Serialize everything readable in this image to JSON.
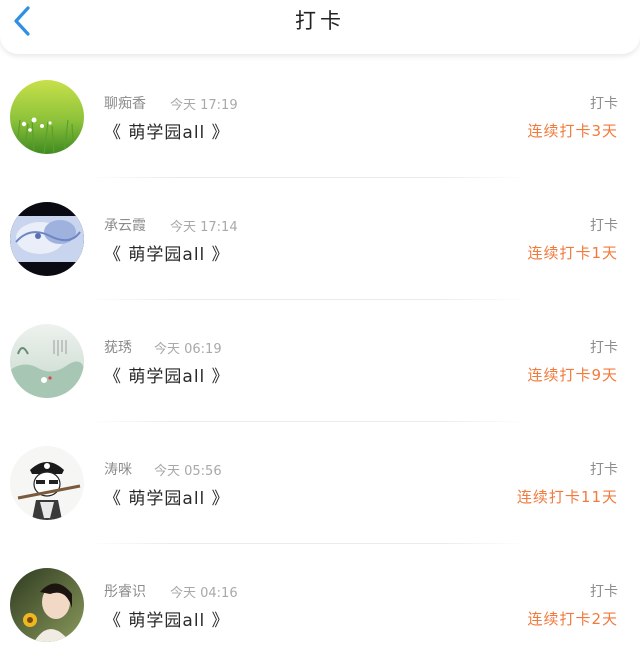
{
  "header": {
    "back_icon": "chevron-left-icon",
    "title": "打卡",
    "accent_color": "#2f8fe4"
  },
  "checkins": [
    {
      "name": "聊痴香",
      "time": "今天 17:19",
      "book": "《 萌学园all 》",
      "action": "打卡",
      "streak": "连续打卡3天"
    },
    {
      "name": "承云霞",
      "time": "今天 17:14",
      "book": "《 萌学园all 》",
      "action": "打卡",
      "streak": "连续打卡1天"
    },
    {
      "name": "莸琇",
      "time": "今天 06:19",
      "book": "《 萌学园all 》",
      "action": "打卡",
      "streak": "连续打卡9天"
    },
    {
      "name": "涛咪",
      "time": "今天 05:56",
      "book": "《 萌学园all 》",
      "action": "打卡",
      "streak": "连续打卡11天"
    },
    {
      "name": "彤睿识",
      "time": "今天 04:16",
      "book": "《 萌学园all 》",
      "action": "打卡",
      "streak": "连续打卡2天"
    }
  ],
  "colors": {
    "streak": "#f27a3c",
    "muted": "#8c8c8c"
  }
}
